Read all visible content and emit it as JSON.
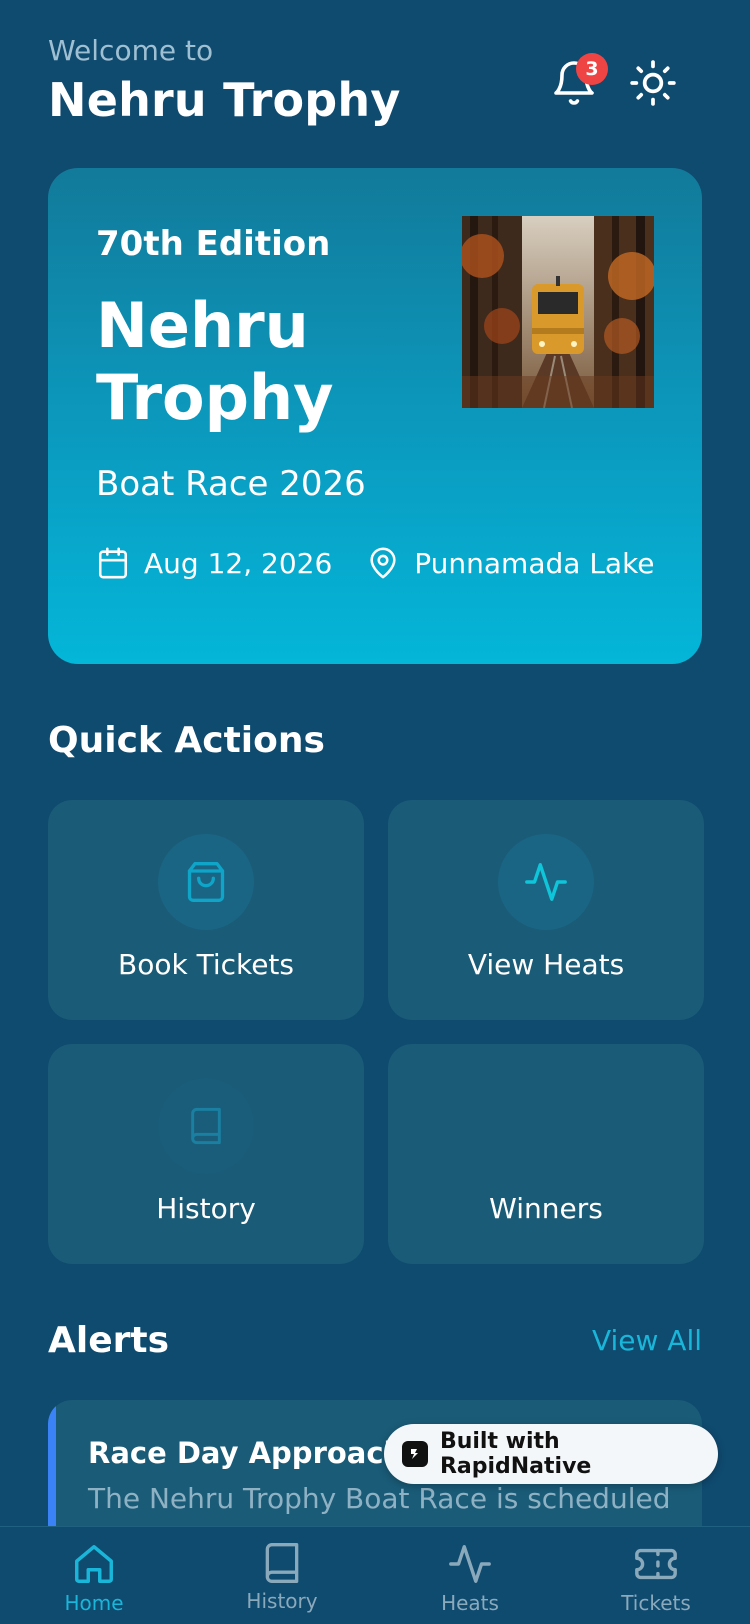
{
  "header": {
    "welcome": "Welcome to",
    "title": "Nehru Trophy",
    "notification_count": "3"
  },
  "hero": {
    "edition": "70th Edition",
    "title": "Nehru Trophy",
    "subtitle": "Boat Race 2026",
    "date": "Aug 12, 2026",
    "location": "Punnamada Lake"
  },
  "quick_actions": {
    "title": "Quick Actions",
    "items": [
      {
        "label": "Book Tickets",
        "icon": "shopping-bag-icon"
      },
      {
        "label": "View Heats",
        "icon": "activity-icon"
      },
      {
        "label": "History",
        "icon": "book-icon"
      },
      {
        "label": "Winners",
        "icon": ""
      }
    ]
  },
  "alerts": {
    "title": "Alerts",
    "view_all": "View All",
    "items": [
      {
        "title": "Race Day Approaching",
        "body": "The Nehru Trophy Boat Race is scheduled"
      }
    ]
  },
  "badge": {
    "label": "Built with RapidNative"
  },
  "tabs": [
    {
      "label": "Home",
      "active": true
    },
    {
      "label": "History",
      "active": false
    },
    {
      "label": "Heats",
      "active": false
    },
    {
      "label": "Tickets",
      "active": false
    }
  ],
  "colors": {
    "background": "#0f4a6f",
    "accent": "#1ab6d9",
    "card": "#1a5b77",
    "badge": "#ef4444",
    "alert_bar": "#3b82f6"
  }
}
